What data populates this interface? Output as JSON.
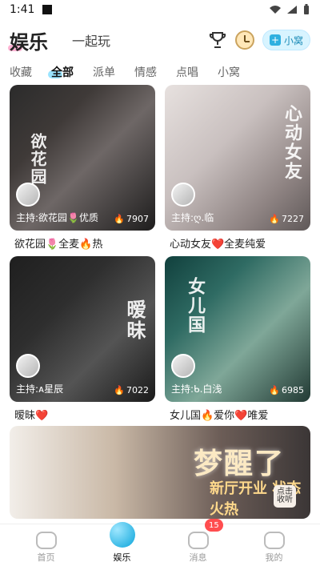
{
  "status": {
    "time": "1:41"
  },
  "header": {
    "brand": "娱乐",
    "together": "一起玩",
    "small_room": "小窝"
  },
  "tabs": [
    "收藏",
    "全部",
    "派单",
    "情感",
    "点唱",
    "小窝"
  ],
  "cards": [
    {
      "art": "欲花园",
      "host": "主持:欲花园🌷优质",
      "hot": "7907",
      "label": "欲花园🌷全麦🔥热"
    },
    {
      "art": "心动女友",
      "host": "主持:ღ.临",
      "hot": "7227",
      "label": "心动女友❤️全麦纯爱"
    },
    {
      "art": "暧昧",
      "host": "主持:ᴀ星辰",
      "hot": "7022",
      "label": "暧昧❤️"
    },
    {
      "art": "女儿国",
      "host": "主持:ᑲ.白浅",
      "hot": "6985",
      "label": "女儿国🔥爱你❤️唯爱"
    }
  ],
  "banner": {
    "title": "梦醒了",
    "subtitle": "新厅开业 状态火热",
    "click": "点击 收听"
  },
  "bottom_nav": {
    "items": [
      "首页",
      "娱乐",
      "消息",
      "我的"
    ],
    "badge": "15"
  }
}
